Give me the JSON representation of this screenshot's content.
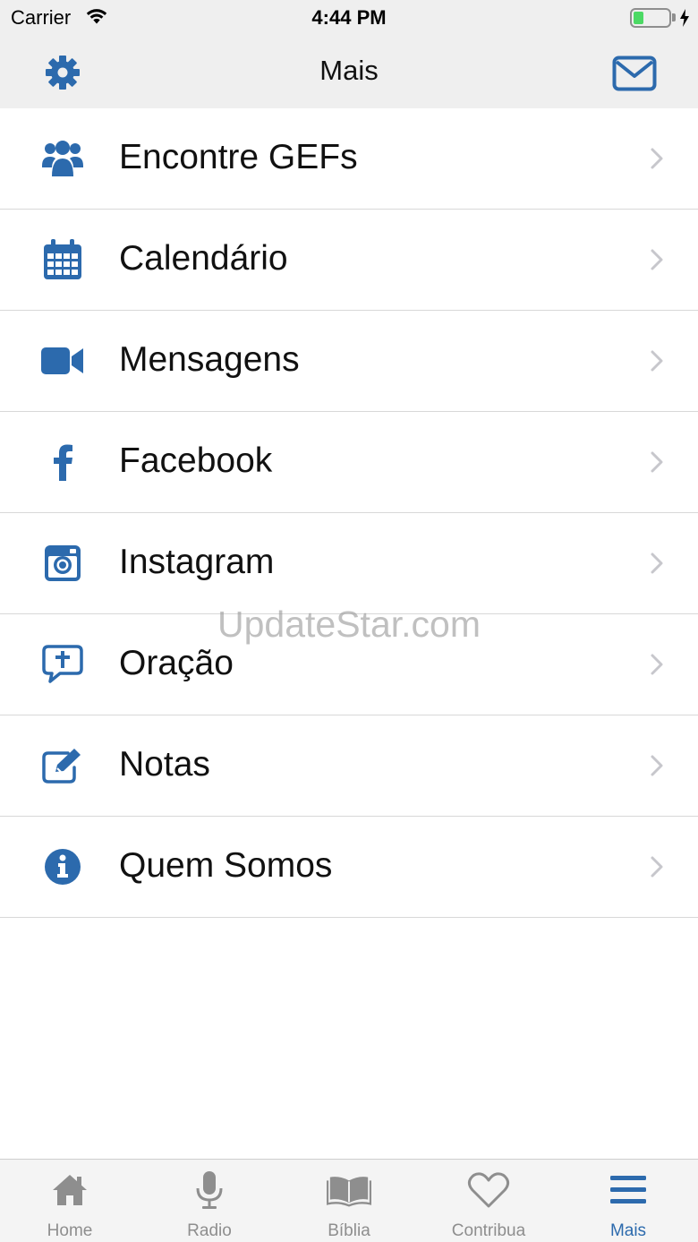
{
  "status_bar": {
    "carrier": "Carrier",
    "time": "4:44 PM",
    "battery_level": 0.3
  },
  "nav": {
    "title": "Mais",
    "left_icon": "gear-icon",
    "right_icon": "mail-icon"
  },
  "menu": [
    {
      "label": "Encontre GEFs",
      "icon": "users-icon"
    },
    {
      "label": "Calendário",
      "icon": "calendar-icon"
    },
    {
      "label": "Mensagens",
      "icon": "video-camera-icon"
    },
    {
      "label": "Facebook",
      "icon": "facebook-icon"
    },
    {
      "label": "Instagram",
      "icon": "instagram-icon"
    },
    {
      "label": "Oração",
      "icon": "prayer-chat-icon"
    },
    {
      "label": "Notas",
      "icon": "edit-note-icon"
    },
    {
      "label": "Quem Somos",
      "icon": "info-icon"
    }
  ],
  "watermark": "UpdateStar.com",
  "tabbar": {
    "tabs": [
      {
        "label": "Home",
        "icon": "home-icon"
      },
      {
        "label": "Radio",
        "icon": "microphone-icon"
      },
      {
        "label": "Bíblia",
        "icon": "book-icon"
      },
      {
        "label": "Contribua",
        "icon": "heart-icon"
      },
      {
        "label": "Mais",
        "icon": "menu-icon"
      }
    ],
    "active_index": 4
  },
  "colors": {
    "accent": "#2c6aad",
    "inactive": "#8e8e8e",
    "bar_background": "#efefef",
    "separator": "#d8d8d8"
  }
}
